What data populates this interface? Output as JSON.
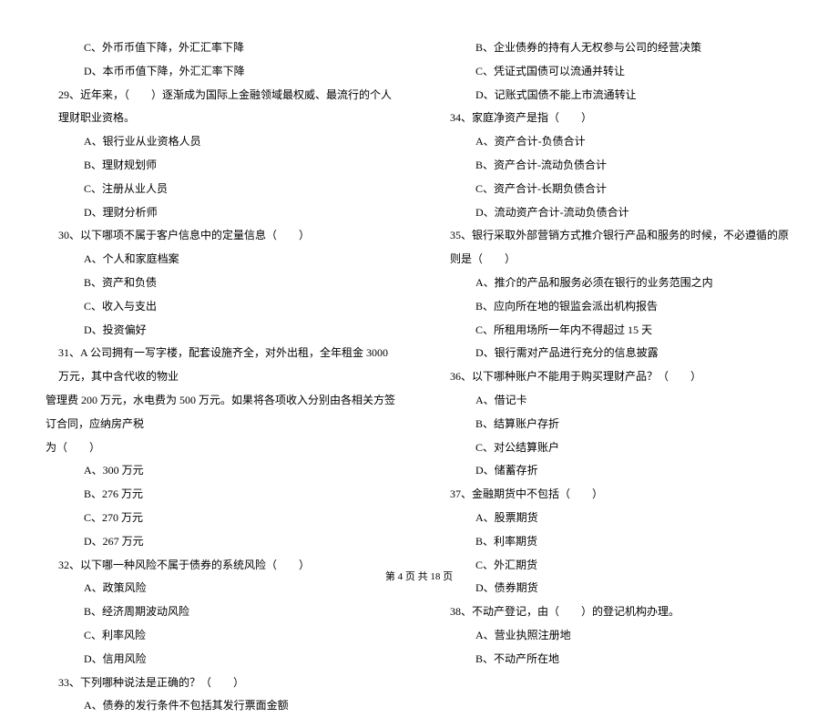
{
  "left": {
    "l1": "C、外币币值下降，外汇汇率下降",
    "l2": "D、本币币值下降，外汇汇率下降",
    "l3": "29、近年来，（　　）逐渐成为国际上金融领域最权威、最流行的个人理财职业资格。",
    "l4": "A、银行业从业资格人员",
    "l5": "B、理财规划师",
    "l6": "C、注册从业人员",
    "l7": "D、理财分析师",
    "l8": "30、以下哪项不属于客户信息中的定量信息（　　）",
    "l9": "A、个人和家庭档案",
    "l10": "B、资产和负债",
    "l11": "C、收入与支出",
    "l12": "D、投资偏好",
    "l13a": "31、A 公司拥有一写字楼，配套设施齐全，对外出租，全年租金 3000 万元，其中含代收的物业",
    "l13b": "管理费 200 万元，水电费为 500 万元。如果将各项收入分别由各相关方签订合同，应纳房产税",
    "l13c": "为（　　）",
    "l14": "A、300 万元",
    "l15": "B、276 万元",
    "l16": "C、270 万元",
    "l17": "D、267 万元",
    "l18": "32、以下哪一种风险不属于债券的系统风险（　　）",
    "l19": "A、政策风险",
    "l20": "B、经济周期波动风险",
    "l21": "C、利率风险",
    "l22": "D、信用风险",
    "l23": "33、下列哪种说法是正确的？（　　）",
    "l24": "A、债券的发行条件不包括其发行票面金额"
  },
  "right": {
    "r1": "B、企业债券的持有人无权参与公司的经营决策",
    "r2": "C、凭证式国债可以流通并转让",
    "r3": "D、记账式国债不能上市流通转让",
    "r4": "34、家庭净资产是指（　　）",
    "r5": "A、资产合计-负债合计",
    "r6": "B、资产合计-流动负债合计",
    "r7": "C、资产合计-长期负债合计",
    "r8": "D、流动资产合计-流动负债合计",
    "r9": "35、银行采取外部营销方式推介银行产品和服务的时候，不必遵循的原则是（　　）",
    "r10": "A、推介的产品和服务必须在银行的业务范围之内",
    "r11": "B、应向所在地的银监会派出机构报告",
    "r12": "C、所租用场所一年内不得超过 15 天",
    "r13": "D、银行需对产品进行充分的信息披露",
    "r14": "36、以下哪种账户不能用于购买理财产品？（　　）",
    "r15": "A、借记卡",
    "r16": "B、结算账户存折",
    "r17": "C、对公结算账户",
    "r18": "D、储蓄存折",
    "r19": "37、金融期货中不包括（　　）",
    "r20": "A、股票期货",
    "r21": "B、利率期货",
    "r22": "C、外汇期货",
    "r23": "D、债券期货",
    "r24": "38、不动产登记，由（　　）的登记机构办理。",
    "r25": "A、营业执照注册地",
    "r26": "B、不动产所在地"
  },
  "footer": "第 4 页 共 18 页"
}
